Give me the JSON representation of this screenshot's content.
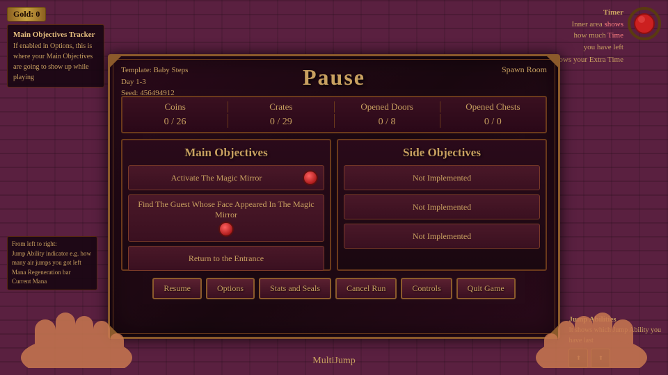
{
  "topLeft": {
    "goldLabel": "Gold:",
    "goldValue": "0",
    "panelTitle": "Main Objectives Tracker",
    "panelDesc": "If enabled in Options, this is where your Main Objectives are going to show up while playing"
  },
  "timer": {
    "label": "Timer",
    "innerDesc": "Inner area shows how much Time you have left",
    "outerDesc": "Outer ring shows your Extra Time"
  },
  "template": {
    "line1": "Template: Baby Steps",
    "line2": "Day 1-3",
    "line3": "Seed: 456494912"
  },
  "spawnRoom": "Spawn Room",
  "pauseTitle": "Pause",
  "stats": {
    "columns": [
      "Coins",
      "Crates",
      "Opened Doors",
      "Opened Chests"
    ],
    "values": [
      "0 / 26",
      "0 / 29",
      "0 / 8",
      "0 / 0"
    ]
  },
  "mainObjectives": {
    "title": "Main Objectives",
    "items": [
      "Activate The Magic Mirror",
      "Find The Guest Whose Face Appeared In The Magic Mirror",
      "Return to the Entrance"
    ]
  },
  "sideObjectives": {
    "title": "Side Objectives",
    "items": [
      "Not Implemented",
      "Not Implemented",
      "Not Implemented"
    ]
  },
  "buttons": {
    "resume": "Resume",
    "options": "Options",
    "statsAndSeals": "Stats and Seals",
    "cancelRun": "Cancel Run",
    "controls": "Controls",
    "quitGame": "Quit Game"
  },
  "bottomLeft": {
    "fromLeftRight": "From left to right:",
    "item1": "Jump Ability indicator e.g. how many air jumps you got left",
    "item2": "Mana Regeneration bar",
    "item3": "Current Mana"
  },
  "bottomRight": {
    "jumpAbilities": "Jump Abilities",
    "desc": "It shows which Jump Ability you",
    "desc2": "have last"
  },
  "multiJump": "MultiJump"
}
